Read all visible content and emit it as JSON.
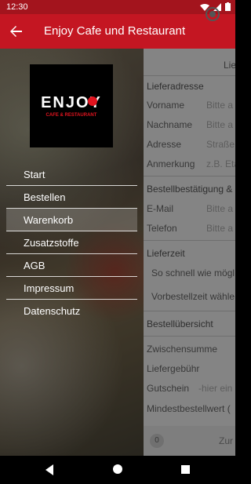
{
  "status": {
    "time": "12:30"
  },
  "app_bar": {
    "title": "Enjoy Cafe und Restaurant"
  },
  "drawer": {
    "logo": {
      "brand": "ENJOY",
      "sub": "CAFE & RESTAURANT"
    },
    "items": [
      {
        "label": "Start"
      },
      {
        "label": "Bestellen"
      },
      {
        "label": "Warenkorb"
      },
      {
        "label": "Zusatzstoffe"
      },
      {
        "label": "AGB"
      },
      {
        "label": "Impressum"
      },
      {
        "label": "Datenschutz"
      }
    ],
    "active_index": 2
  },
  "form": {
    "delivery_option": "Lie",
    "sections": {
      "address": "Lieferadresse",
      "confirmation": "Bestellbestätigung &",
      "delivery_time": "Lieferzeit",
      "summary": "Bestellübersicht"
    },
    "fields": {
      "vorname": {
        "label": "Vorname",
        "placeholder": "Bitte a"
      },
      "nachname": {
        "label": "Nachname",
        "placeholder": "Bitte a"
      },
      "adresse": {
        "label": "Adresse",
        "placeholder": "Straße"
      },
      "anmerkung": {
        "label": "Anmerkung",
        "placeholder": "z.B. Eta"
      },
      "email": {
        "label": "E-Mail",
        "placeholder": "Bitte a"
      },
      "telefon": {
        "label": "Telefon",
        "placeholder": "Bitte a"
      }
    },
    "delivery_options": [
      "So schnell wie mögl",
      "Vorbestellzeit wähle"
    ],
    "summary_rows": {
      "zwischensumme": "Zwischensumme",
      "liefergebuehr": "Liefergebühr",
      "gutschein_label": "Gutschein",
      "gutschein_placeholder": "-hier ein",
      "mindestbestellwert": "Mindestbestellwert ("
    },
    "bottom": {
      "count": "0",
      "label": "Zur"
    }
  }
}
